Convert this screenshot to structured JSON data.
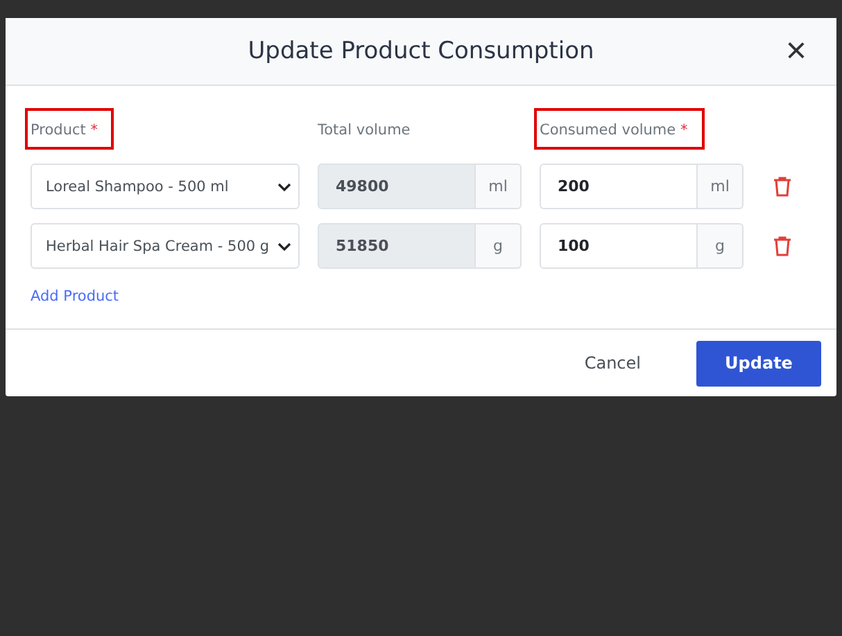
{
  "dialog": {
    "title": "Update Product Consumption",
    "close_icon": "×"
  },
  "columns": [
    {
      "label": "Product",
      "required_mark": "*",
      "highlighted": true
    },
    {
      "label": "Total volume",
      "highlighted": false
    },
    {
      "label": "Consumed volume",
      "required_mark": "*",
      "highlighted": true
    }
  ],
  "rows": [
    {
      "product": "Loreal Shampoo - 500 ml",
      "total_volume": "49800",
      "total_unit": "ml",
      "consumed_volume": "200",
      "consumed_unit": "ml"
    },
    {
      "product": "Herbal Hair Spa Cream - 500 g",
      "total_volume": "51850",
      "total_unit": "g",
      "consumed_volume": "100",
      "consumed_unit": "g"
    }
  ],
  "add_link": "Add Product",
  "buttons": {
    "cancel": "Cancel",
    "update": "Update"
  }
}
